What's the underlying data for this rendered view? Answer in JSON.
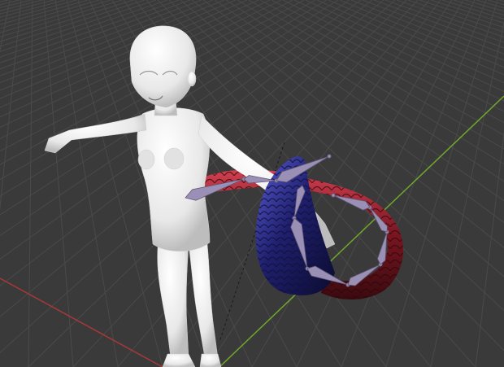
{
  "viewport": {
    "background": "#3a3a3a",
    "grid_color": "#4a4a4a",
    "grid_color_major": "#505050",
    "x_axis_color": "#b03a3a",
    "y_axis_color": "#6fa82c"
  },
  "scene": {
    "objects": [
      {
        "name": "character-body",
        "material_color": "#efefef"
      },
      {
        "name": "tail-red-mesh",
        "material_color": "#8e1d24"
      },
      {
        "name": "tail-blue-mesh",
        "material_color": "#26267a"
      },
      {
        "name": "armature",
        "bone_color": "#9a8fb5"
      }
    ]
  }
}
